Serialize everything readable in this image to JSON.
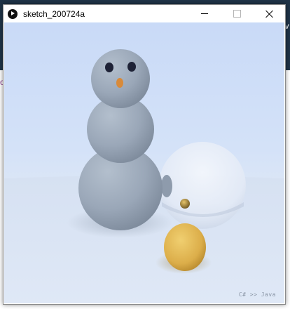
{
  "window": {
    "title": "sketch_200724a"
  },
  "background_app": {
    "side_text": "av",
    "left_text": "o"
  },
  "canvas": {
    "watermark": "C# >> Java",
    "colors": {
      "sky_top": "#c9daf7",
      "snow": "#dbe6f6",
      "snowman": "#98a5b6",
      "eyes": "#1e2236",
      "nose": "#d88a3a",
      "egg": "#e0b653",
      "glass_sphere": "#e8eef8"
    }
  },
  "icons": {
    "app": "processing-play-icon",
    "minimize": "minimize-icon",
    "maximize": "maximize-icon",
    "close": "close-icon"
  }
}
